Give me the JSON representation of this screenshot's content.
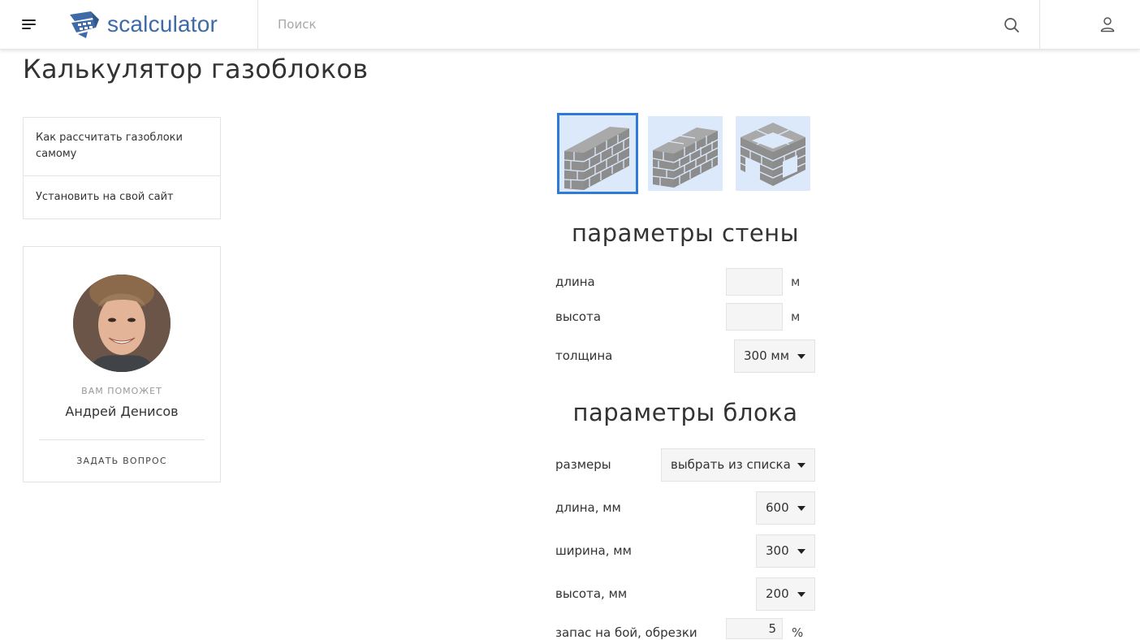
{
  "header": {
    "logo_text": "scalculator",
    "search_placeholder": "Поиск"
  },
  "page": {
    "title": "Калькулятор газоблоков"
  },
  "menu": {
    "items": [
      {
        "label": "Как рассчитать газоблоки самому"
      },
      {
        "label": "Установить на свой сайт"
      }
    ]
  },
  "expert": {
    "caption": "ВАМ ПОМОЖЕТ",
    "name": "Андрей Денисов",
    "ask_label": "ЗАДАТЬ ВОПРОС"
  },
  "wall_types": {
    "selected_index": 0,
    "items": [
      "single-wall-icon",
      "thick-wall-icon",
      "box-walls-icon"
    ]
  },
  "wall_params": {
    "title": "параметры стены",
    "length": {
      "label": "длина",
      "value": "",
      "unit": "м"
    },
    "height": {
      "label": "высота",
      "value": "",
      "unit": "м"
    },
    "thickness": {
      "label": "толщина",
      "value": "300 мм"
    }
  },
  "block_params": {
    "title": "параметры блока",
    "sizes": {
      "label": "размеры",
      "value": "выбрать из списка"
    },
    "length": {
      "label": "длина, мм",
      "value": "600"
    },
    "width": {
      "label": "ширина, мм",
      "value": "300"
    },
    "height": {
      "label": "высота, мм",
      "value": "200"
    },
    "reserve": {
      "label": "запас на бой, обрезки",
      "value": "5",
      "unit": "%"
    }
  },
  "colors": {
    "brand": "#3e6aa8",
    "selected_border": "#2f7ad8",
    "thumb_bg": "#dbe9fb",
    "brick": "#8c8c8c"
  }
}
